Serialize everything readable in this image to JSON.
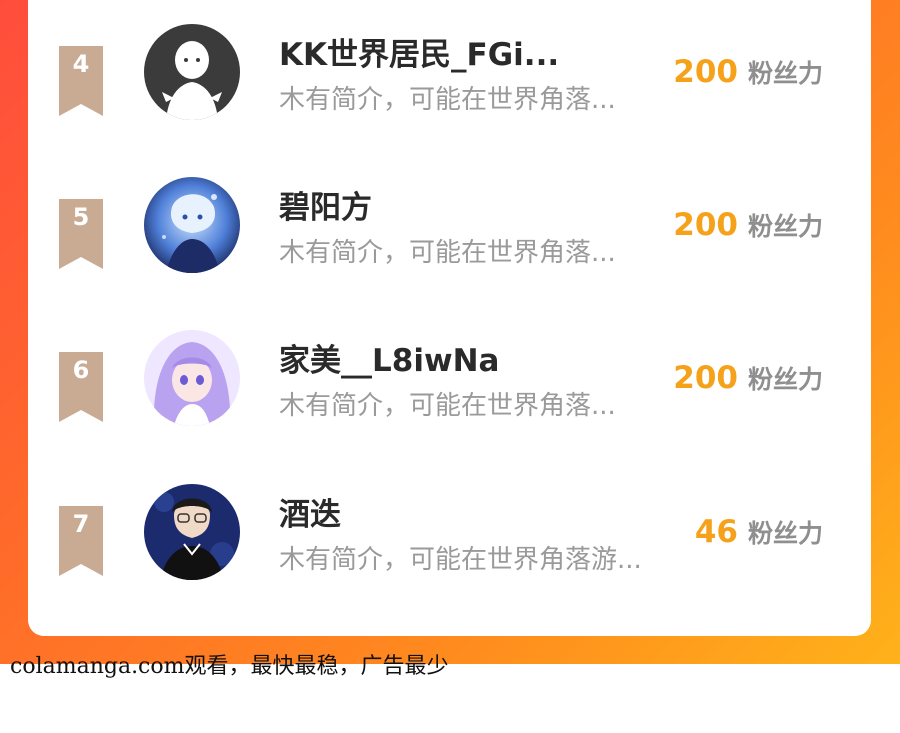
{
  "ranking": {
    "entries": [
      {
        "rank": "4",
        "name": "KK世界居民_FGi...",
        "bio": "木有简介，可能在世界角落...",
        "fans_count": "200",
        "fans_label": "粉丝力",
        "avatar_icon": "default-user-avatar"
      },
      {
        "rank": "5",
        "name": "碧阳方",
        "bio": "木有简介，可能在世界角落...",
        "fans_count": "200",
        "fans_label": "粉丝力",
        "avatar_icon": "anime-character-avatar"
      },
      {
        "rank": "6",
        "name": "家美__L8iwNa",
        "bio": "木有简介，可能在世界角落...",
        "fans_count": "200",
        "fans_label": "粉丝力",
        "avatar_icon": "anime-girl-avatar"
      },
      {
        "rank": "7",
        "name": "酒迭",
        "bio": "木有简介，可能在世界角落游...",
        "fans_count": "46",
        "fans_label": "粉丝力",
        "avatar_icon": "person-photo-avatar"
      }
    ]
  },
  "footer": {
    "text": "colamanga.com观看，最快最稳，广告最少"
  },
  "colors": {
    "accent_orange": "#f5a21a",
    "badge": "#c9ab93",
    "gradient_start": "#ff4d3d",
    "gradient_end": "#ffb21a"
  }
}
